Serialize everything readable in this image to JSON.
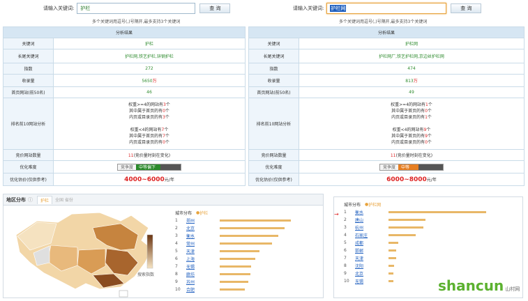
{
  "left": {
    "search_label": "请输入关键词:",
    "search_value": "护栏",
    "query_button": "查 询",
    "hint": "多个关键词用逗号(,)号隔开,最多支持3个关键词",
    "table_title": "分析结果",
    "rows": {
      "keyword_label": "关键词",
      "keyword": "护栏",
      "longtail_label": "长尾关键词",
      "longtail": "护栏网,铁艺护栏,锌钢护栏",
      "index_label": "指数",
      "index": "272",
      "indexed_label": "收录量",
      "indexed": "5650",
      "indexed_unit": "万",
      "top50_label": "首页网站(前50名)",
      "top50": "46",
      "top10_label": "排名前10网站分析",
      "a1": "权重>=4的网站有",
      "a1v": "3",
      "a1u": "个",
      "a2": "其中属于首页的有",
      "a2v": "0",
      "a2u": "个",
      "a3": "内页或目录页的有",
      "a3v": "3",
      "a3u": "个",
      "b1": "权重<4的网站有",
      "b1v": "7",
      "b1u": "个",
      "b2": "其中属于首页的有",
      "b2v": "7",
      "b2u": "个",
      "b3": "内页或目录页的有",
      "b3v": "0",
      "b3u": "个",
      "bid_label": "竞价网站数量",
      "bid_v": "11",
      "bid_rest": "(竞价量时刻在变化)",
      "diff_label": "优化难度",
      "diff_tag": "竞争度",
      "diff_value": "中等偏下",
      "price_label": "优化估价(仅供参考)",
      "price": "4000~6000",
      "price_unit": "元/年"
    }
  },
  "right": {
    "search_label": "请输入关键词:",
    "search_value": "护栏网",
    "query_button": "查 询",
    "hint": "多个关键词用逗号(,)号隔开,最多支持3个关键词",
    "table_title": "分析结果",
    "rows": {
      "keyword_label": "关键词",
      "keyword": "护栏网",
      "longtail_label": "长尾关键词",
      "longtail": "护栏网厂,铁艺护栏网,京边丝护栏网",
      "index_label": "指数",
      "index": "474",
      "indexed_label": "收录量",
      "indexed": "813",
      "indexed_unit": "万",
      "top50_label": "首页网站(前50名)",
      "top50": "49",
      "top10_label": "排名前10网站分析",
      "a1": "权重>=4的网站有",
      "a1v": "1",
      "a1u": "个",
      "a2": "其中属于首页的有",
      "a2v": "0",
      "a2u": "个",
      "a3": "内页或目录页的有",
      "a3v": "1",
      "a3u": "个",
      "b1": "权重<4的网站有",
      "b1v": "9",
      "b1u": "个",
      "b2": "其中属于首页的有",
      "b2v": "9",
      "b2u": "个",
      "b3": "内页或目录页的有",
      "b3v": "0",
      "b3u": "个",
      "bid_label": "竞价网站数量",
      "bid_v": "11",
      "bid_rest": "(竞价量时刻在变化)",
      "diff_label": "优化难度",
      "diff_tag": "竞争度",
      "diff_value": "中等",
      "price_label": "优化估价(仅供参考)",
      "price": "6000~8000",
      "price_unit": "元/年"
    }
  },
  "map_panel": {
    "title": "地区分布",
    "tab_active": "护栏",
    "tab_inactive": "全国 省份",
    "legend_text": "搜索指数",
    "col_header": "城市分布",
    "legend_label": "护栏",
    "cities": [
      {
        "rank": "1",
        "name": "郑州",
        "value": 0.68
      },
      {
        "rank": "2",
        "name": "北京",
        "value": 0.62
      },
      {
        "rank": "3",
        "name": "衡水",
        "value": 0.56
      },
      {
        "rank": "4",
        "name": "常州",
        "value": 0.5
      },
      {
        "rank": "5",
        "name": "天津",
        "value": 0.38
      },
      {
        "rank": "6",
        "name": "上海",
        "value": 0.34
      },
      {
        "rank": "7",
        "name": "无锡",
        "value": 0.3
      },
      {
        "rank": "8",
        "name": "廊坊",
        "value": 0.29
      },
      {
        "rank": "9",
        "name": "苏州",
        "value": 0.27
      },
      {
        "rank": "10",
        "name": "合肥",
        "value": 0.24
      }
    ]
  },
  "right_panel": {
    "col_header": "城市分布",
    "legend_label": "护栏网",
    "cities": [
      {
        "rank": "1",
        "name": "衡水",
        "value": 1.0
      },
      {
        "rank": "2",
        "name": "唐山",
        "value": 0.38
      },
      {
        "rank": "3",
        "name": "杭州",
        "value": 0.36
      },
      {
        "rank": "4",
        "name": "石家庄",
        "value": 0.28
      },
      {
        "rank": "5",
        "name": "成都",
        "value": 0.1
      },
      {
        "rank": "6",
        "name": "邯郸",
        "value": 0.08
      },
      {
        "rank": "7",
        "name": "天津",
        "value": 0.08
      },
      {
        "rank": "8",
        "name": "沈阳",
        "value": 0.06
      },
      {
        "rank": "9",
        "name": "北京",
        "value": 0.05
      },
      {
        "rank": "10",
        "name": "无锡",
        "value": 0.05
      }
    ]
  },
  "watermark": {
    "text": "shancun",
    "small": "山村网"
  },
  "colors": {
    "green": "#2e8b2e",
    "red": "#d22",
    "header": "#d6e6f3",
    "bar": "#e8b767"
  }
}
